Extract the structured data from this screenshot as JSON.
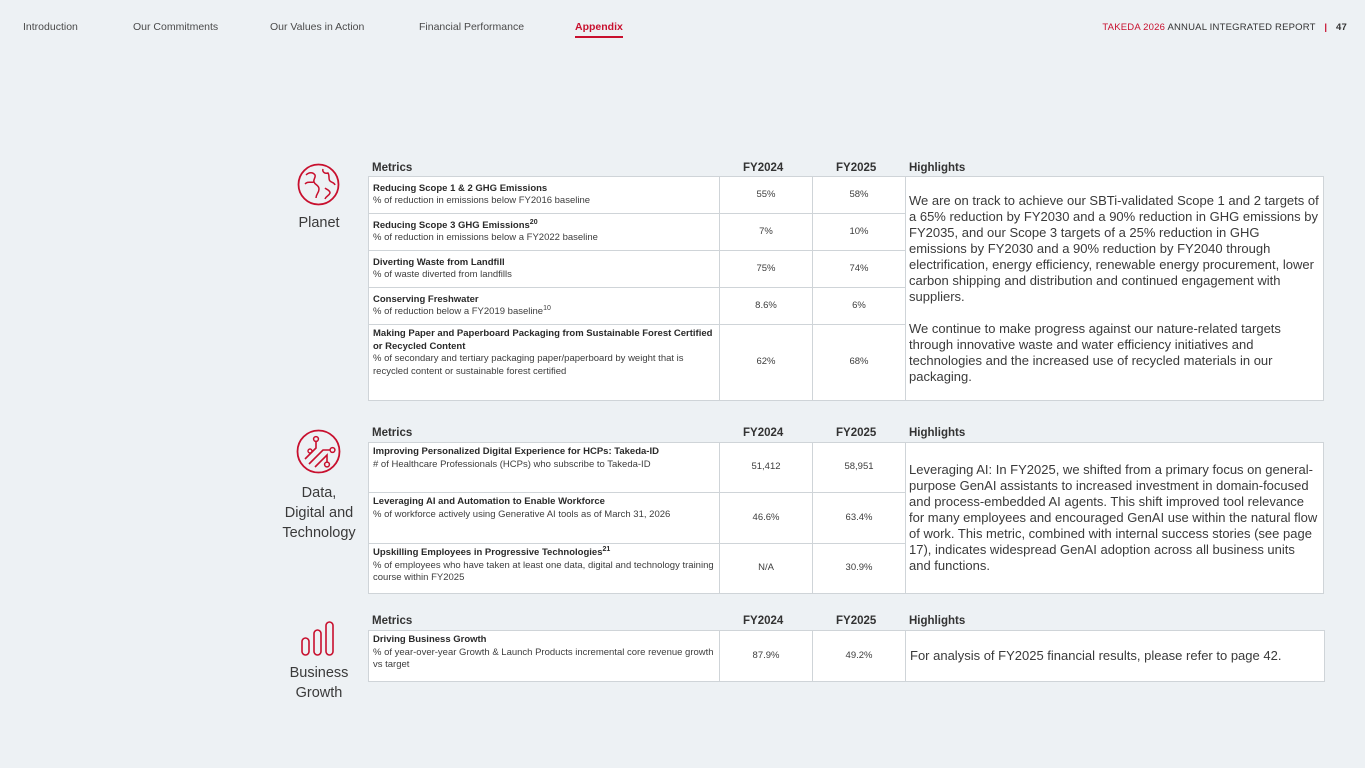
{
  "nav": {
    "items": [
      "Introduction",
      "Our Commitments",
      "Our Values in Action",
      "Financial Performance",
      "Appendix"
    ],
    "active": "Appendix"
  },
  "report": {
    "brand": "TAKEDA 2026",
    "title": "ANNUAL INTEGRATED REPORT",
    "separator": "|",
    "page": "47"
  },
  "headers": {
    "metrics": "Metrics",
    "fy2024": "FY2024",
    "fy2025": "FY2025",
    "highlights": "Highlights"
  },
  "planet": {
    "label": "Planet",
    "rows": [
      {
        "title": "Reducing Scope 1 & 2 GHG Emissions",
        "sup": "",
        "desc": "% of reduction in emissions below FY2016 baseline",
        "desc_sup": "",
        "fy2024": "55%",
        "fy2025": "58%"
      },
      {
        "title": "Reducing Scope 3 GHG Emissions",
        "sup": "20",
        "desc": "% of reduction in emissions below a FY2022 baseline",
        "desc_sup": "",
        "fy2024": "7%",
        "fy2025": "10%"
      },
      {
        "title": "Diverting Waste from Landfill",
        "sup": "",
        "desc": "% of waste diverted from landfills",
        "desc_sup": "",
        "fy2024": "75%",
        "fy2025": "74%"
      },
      {
        "title": "Conserving Freshwater",
        "sup": "",
        "desc": "% of reduction below a FY2019 baseline",
        "desc_sup": "10",
        "fy2024": "8.6%",
        "fy2025": "6%"
      },
      {
        "title": "Making Paper and Paperboard Packaging from Sustainable Forest Certified or Recycled Content",
        "sup": "",
        "desc": "% of secondary and tertiary packaging paper/paperboard by weight that is recycled content or sustainable forest certified",
        "desc_sup": "",
        "fy2024": "62%",
        "fy2025": "68%"
      }
    ],
    "highlights": [
      "We are on track to achieve our SBTi-validated Scope 1 and 2 targets of a 65% reduction by FY2030 and a 90% reduction in GHG emissions by FY2035, and our Scope 3 targets of a 25% reduction in GHG emissions by FY2030 and a 90% reduction by FY2040 through electrification, energy efficiency, renewable energy procurement, lower carbon shipping and distribution and continued engagement with suppliers.",
      "We continue to make progress against our nature-related targets through innovative waste and water efficiency initiatives and technologies and the increased use of recycled materials in our packaging."
    ]
  },
  "data_tech": {
    "label_lines": [
      "Data,",
      "Digital and",
      "Technology"
    ],
    "rows": [
      {
        "title": "Improving Personalized Digital Experience for HCPs: Takeda-ID",
        "sup": "",
        "desc": "# of Healthcare Professionals (HCPs) who subscribe to Takeda-ID",
        "desc_sup": "",
        "fy2024": "51,412",
        "fy2025": "58,951"
      },
      {
        "title": "Leveraging AI and Automation to Enable Workforce",
        "sup": "",
        "desc": "% of workforce actively using Generative AI tools as of March 31, 2026",
        "desc_sup": "",
        "fy2024": "46.6%",
        "fy2025": "63.4%"
      },
      {
        "title": "Upskilling Employees in Progressive Technologies",
        "sup": "21",
        "desc": "% of employees who have taken at least one data, digital and technology training course within FY2025",
        "desc_sup": "",
        "fy2024": "N/A",
        "fy2025": "30.9%"
      }
    ],
    "highlights": [
      "Leveraging AI: In FY2025, we shifted from a primary focus on general-purpose GenAI assistants to increased investment in domain-focused and process-embedded AI agents. This shift improved tool relevance for many employees and encouraged GenAI use within the natural flow of work. This metric, combined with internal success stories (see page 17), indicates widespread GenAI adoption across all business units and functions."
    ]
  },
  "business": {
    "label_lines": [
      "Business",
      "Growth"
    ],
    "rows": [
      {
        "title": "Driving Business Growth",
        "sup": "",
        "desc": "% of year-over-year Growth & Launch Products incremental core revenue growth vs target",
        "desc_sup": "",
        "fy2024": "87.9%",
        "fy2025": "49.2%"
      }
    ],
    "highlights": [
      "For analysis of FY2025 financial results, please refer to page 42."
    ]
  },
  "colors": {
    "accent": "#c8102e",
    "background": "#edf1f4",
    "border": "#cfd4d8"
  },
  "icons": {
    "planet": "globe-icon",
    "data_tech": "circuit-icon",
    "business": "bar-chart-icon"
  }
}
